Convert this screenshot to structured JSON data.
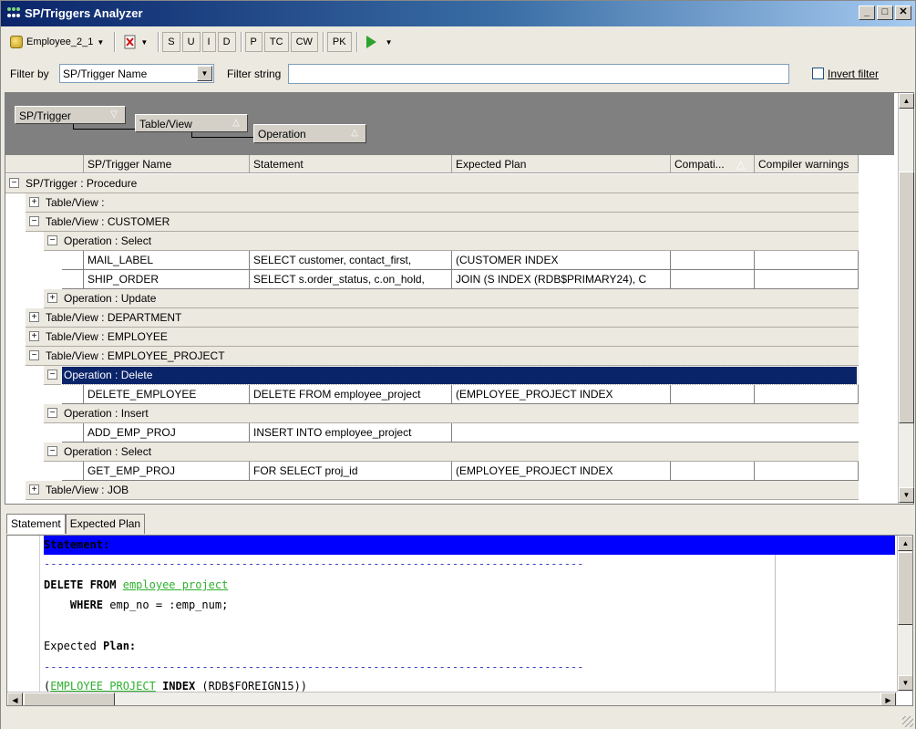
{
  "window": {
    "title": "SP/Triggers Analyzer",
    "controls": [
      "_",
      "□",
      "✕"
    ]
  },
  "toolbar": {
    "connection": "Employee_2_1",
    "filter_buttons": [
      "S",
      "U",
      "I",
      "D",
      "P",
      "TC",
      "CW",
      "PK"
    ]
  },
  "filter": {
    "filter_by_label": "Filter by",
    "filter_by_value": "SP/Trigger Name",
    "filter_string_label": "Filter string",
    "filter_string_value": "",
    "invert_label": "Invert filter"
  },
  "grouping": {
    "level1": "SP/Trigger",
    "level2": "Table/View",
    "level3": "Operation"
  },
  "columns": {
    "name": "SP/Trigger Name",
    "statement": "Statement",
    "plan": "Expected Plan",
    "compat": "Compati...",
    "warnings": "Compiler warnings"
  },
  "tree": {
    "root": "SP/Trigger : Procedure",
    "tv_empty": "Table/View :",
    "tv_customer": "Table/View : CUSTOMER",
    "op_select_1": "Operation : Select",
    "row1": {
      "name": "MAIL_LABEL",
      "statement": "SELECT customer, contact_first,",
      "plan": "(CUSTOMER INDEX"
    },
    "row2": {
      "name": "SHIP_ORDER",
      "statement": "SELECT s.order_status, c.on_hold,",
      "plan": "JOIN (S INDEX (RDB$PRIMARY24), C"
    },
    "op_update": "Operation : Update",
    "tv_department": "Table/View : DEPARTMENT",
    "tv_employee": "Table/View : EMPLOYEE",
    "tv_employee_project": "Table/View : EMPLOYEE_PROJECT",
    "op_delete": "Operation : Delete",
    "row3": {
      "name": "DELETE_EMPLOYEE",
      "statement": "DELETE FROM employee_project",
      "plan": "(EMPLOYEE_PROJECT INDEX"
    },
    "op_insert": "Operation : Insert",
    "row4": {
      "name": "ADD_EMP_PROJ",
      "statement": "INSERT INTO employee_project",
      "plan": ""
    },
    "op_select_2": "Operation : Select",
    "row5": {
      "name": "GET_EMP_PROJ",
      "statement": "FOR SELECT proj_id",
      "plan": "(EMPLOYEE_PROJECT INDEX"
    },
    "tv_job": "Table/View : JOB"
  },
  "tabs": {
    "statement": "Statement",
    "plan": "Expected Plan"
  },
  "editor": {
    "header": "Statement:",
    "dashes": "----------------------------------------------------------------------------------",
    "line1_kw": "DELETE FROM",
    "line1_ident": "employee project",
    "line2_kw": "WHERE",
    "line2_rest": "emp_no = :emp_num;",
    "plan_label_pre": "Expected",
    "plan_label_kw": "Plan:",
    "plan_open": "(",
    "plan_ident": "EMPLOYEE PROJECT",
    "plan_kw": "INDEX",
    "plan_rest": "(RDB$FOREIGN15))"
  }
}
